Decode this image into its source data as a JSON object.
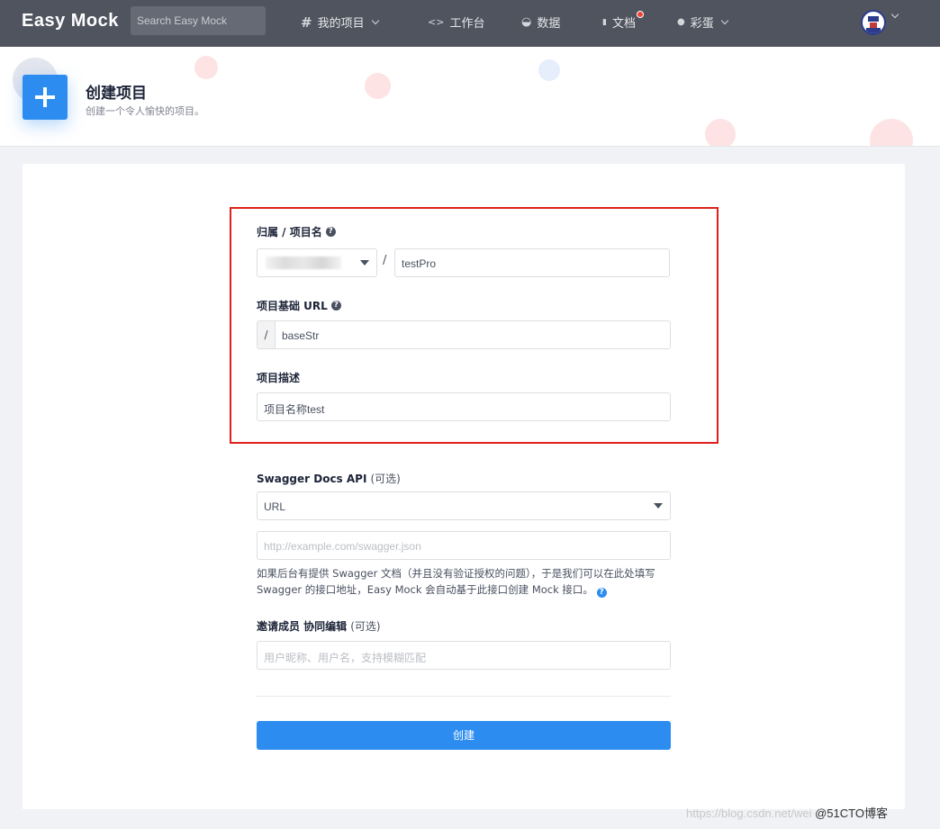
{
  "nav": {
    "logo": "Easy Mock",
    "search_placeholder": "Search Easy Mock",
    "items": [
      {
        "icon": "hash-icon",
        "glyph": "#",
        "label": "我的项目",
        "has_dropdown": true
      },
      {
        "icon": "code-icon",
        "glyph": "<>",
        "label": "工作台",
        "has_dropdown": false
      },
      {
        "icon": "chart-icon",
        "glyph": "◒",
        "label": "数据",
        "has_dropdown": false
      },
      {
        "icon": "book-icon",
        "glyph": "▮",
        "label": "文档",
        "has_dropdown": false,
        "badge": true
      },
      {
        "icon": "egg-icon",
        "glyph": "●",
        "label": "彩蛋",
        "has_dropdown": true
      }
    ]
  },
  "header": {
    "title": "创建项目",
    "subtitle": "创建一个令人愉快的项目。"
  },
  "form": {
    "owner_project_label": "归属 / 项目名",
    "owner_value": "",
    "slash": "/",
    "project_name_value": "testPro",
    "base_url_label": "项目基础 URL",
    "base_url_prefix": "/",
    "base_url_value": "baseStr",
    "description_label": "项目描述",
    "description_value": "项目名称test",
    "swagger_label": "Swagger Docs API",
    "swagger_optional": "(可选)",
    "swagger_type_value": "URL",
    "swagger_url_placeholder": "http://example.com/swagger.json",
    "swagger_hint": "如果后台有提供 Swagger 文档（并且没有验证授权的问题），于是我们可以在此处填写 Swagger 的接口地址，Easy Mock 会自动基于此接口创建 Mock 接口。",
    "members_label": "邀请成员 协同编辑",
    "members_optional": "(可选)",
    "members_placeholder": "用户昵称、用户名，支持模糊匹配",
    "submit_label": "创建"
  },
  "watermark": {
    "url": "https://blog.csdn.net/wei",
    "brand": "@51CTO博客"
  },
  "colors": {
    "nav_bg": "#50545f",
    "primary": "#2d8cf0",
    "highlight_box": "#e0201c"
  }
}
